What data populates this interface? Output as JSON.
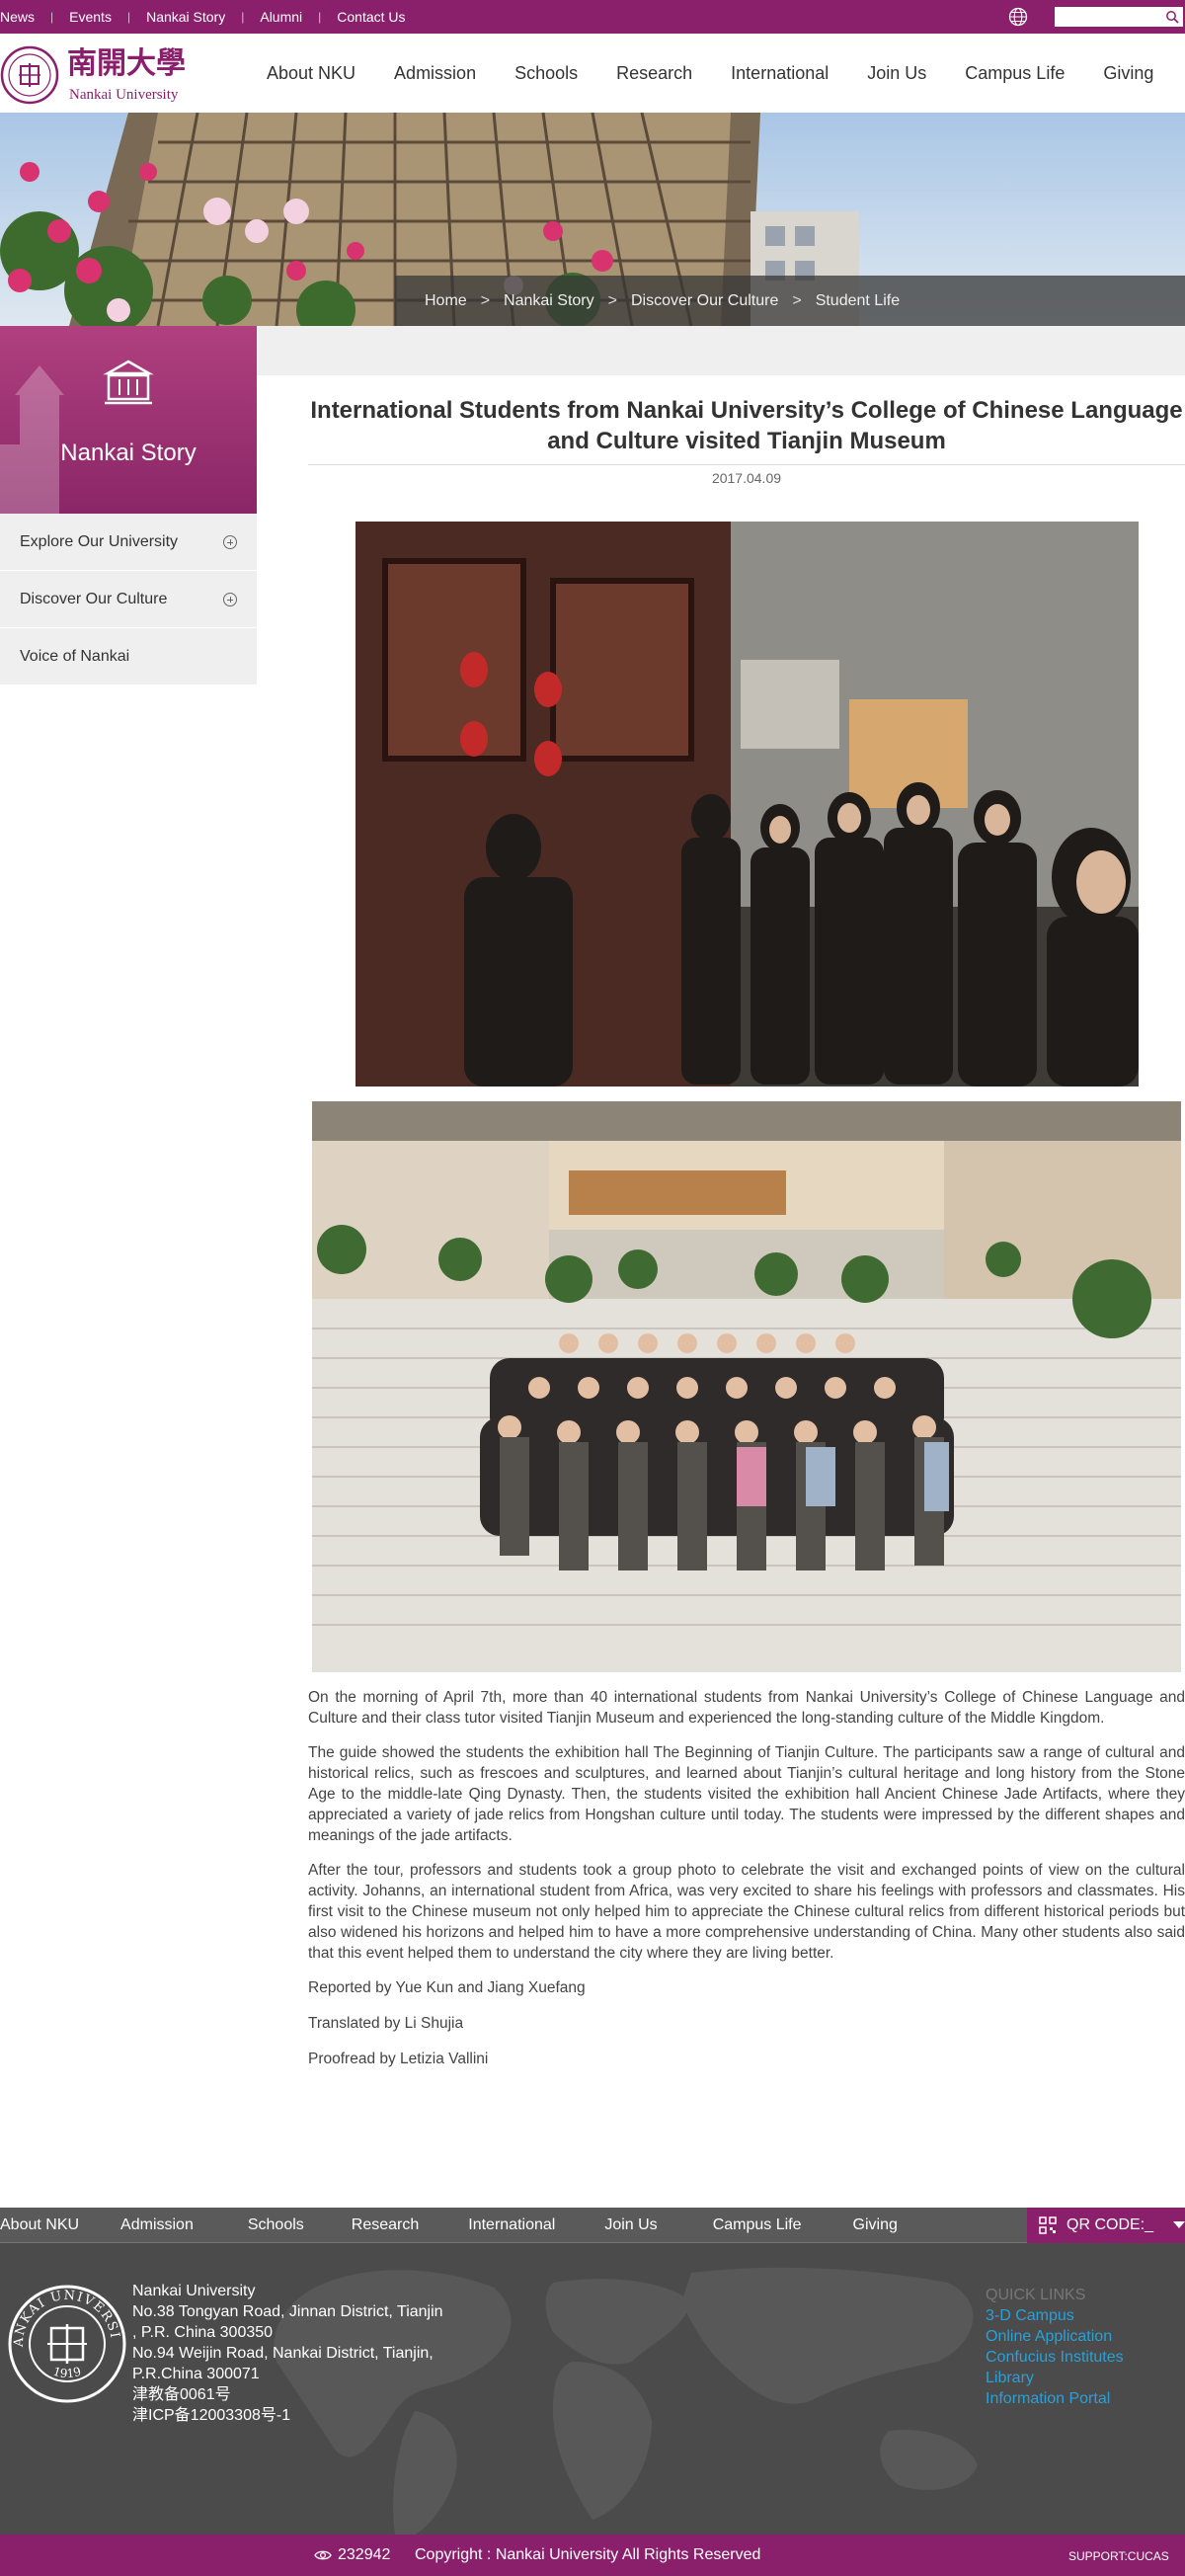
{
  "topbar": {
    "links": [
      "News",
      "Events",
      "Nankai Story",
      "Alumni",
      "Contact Us"
    ],
    "search_placeholder": ""
  },
  "header": {
    "logo_cn": "南開大學",
    "logo_en": "Nankai University",
    "nav": [
      "About NKU",
      "Admission",
      "Schools",
      "Research",
      "International",
      "Join Us",
      "Campus Life",
      "Giving"
    ]
  },
  "breadcrumb": {
    "items": [
      "Home",
      "Nankai Story",
      "Discover Our Culture",
      "Student Life"
    ],
    "separator": ">"
  },
  "sidebar": {
    "title": "Nankai Story",
    "items": [
      {
        "label": "Explore Our University",
        "expandable": true
      },
      {
        "label": "Discover Our Culture",
        "expandable": true
      },
      {
        "label": "Voice of Nankai",
        "expandable": false
      }
    ]
  },
  "article": {
    "title": "International Students from Nankai University’s College of Chinese Language and Culture visited Tianjin Museum",
    "date": "2017.04.09",
    "paragraphs": [
      "On the morning of April 7th, more than 40 international students from Nankai University’s College of Chinese Language and Culture and their class tutor visited Tianjin Museum and experienced the long-standing culture of the Middle Kingdom.",
      "The guide showed the students the exhibition hall The Beginning of Tianjin Culture. The participants saw a range of cultural and historical relics, such as frescoes and sculptures, and learned about Tianjin’s cultural heritage and long history from the Stone Age to the middle-late Qing Dynasty. Then, the students visited the exhibition hall Ancient Chinese Jade Artifacts, where they appreciated a variety of jade relics from Hongshan culture until today. The students were impressed by the different shapes and meanings of the jade artifacts.",
      "After the tour, professors and students took a group photo to celebrate the visit and exchanged points of view on the cultural activity. Johanns, an international student from Africa, was very excited to share his feelings with professors and classmates. His first visit to the Chinese museum not only helped him to appreciate the Chinese cultural relics from different historical periods but also widened his horizons and helped him to have a more comprehensive understanding of China. Many other students also said that this event helped them to understand the city where they are living better."
    ],
    "credits": [
      "Reported by Yue Kun and Jiang Xuefang",
      "Translated by Li Shujia",
      "Proofread by Letizia Vallini"
    ]
  },
  "footer": {
    "nav": [
      "About NKU",
      "Admission",
      "Schools",
      "Research",
      "International",
      "Join Us",
      "Campus Life",
      "Giving"
    ],
    "qr_label": "QR CODE:_",
    "address_lines": [
      "Nankai University",
      "No.38 Tongyan Road, Jinnan District, Tianjin",
      ", P.R. China 300350",
      "No.94 Weijin Road,  Nankai District, Tianjin,",
      "P.R.China  300071",
      "津教备0061号",
      "津ICP备12003308号-1"
    ],
    "seal_text": "NANKAI UNIVERSITY",
    "seal_year": "1919",
    "quick_links_heading": "QUICK LINKS",
    "quick_links": [
      "3-D Campus",
      "Online Application",
      "Confucius Institutes",
      "Library",
      "Information Portal"
    ],
    "visits": "232942",
    "copyright": "Copyright : Nankai University All Rights Reserved",
    "support": "SUPPORT:CUCAS"
  },
  "colors": {
    "brand": "#8a1f6c",
    "link": "#2aa0d8",
    "footer_bg": "#4b4b4b"
  }
}
